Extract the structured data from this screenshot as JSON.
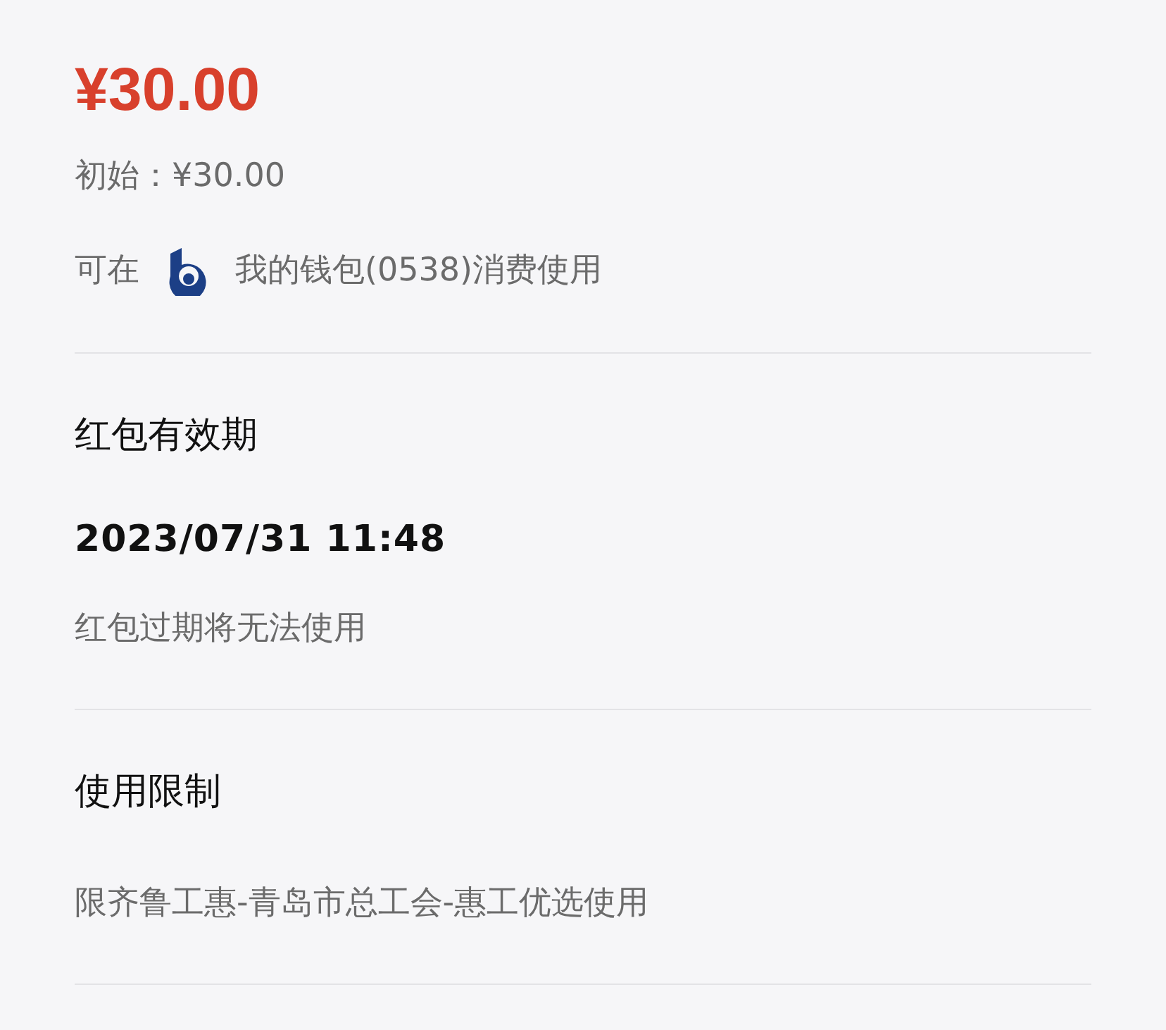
{
  "amount": "¥30.00",
  "initial": "初始：¥30.00",
  "usable_at": {
    "prefix": "可在",
    "wallet": "我的钱包(0538)消费使用"
  },
  "sections": [
    {
      "title": "红包有效期",
      "value": "2023/07/31 11:48",
      "note": "红包过期将无法使用"
    },
    {
      "title": "使用限制",
      "note": "限齐鲁工惠-青岛市总工会-惠工优选使用"
    }
  ]
}
